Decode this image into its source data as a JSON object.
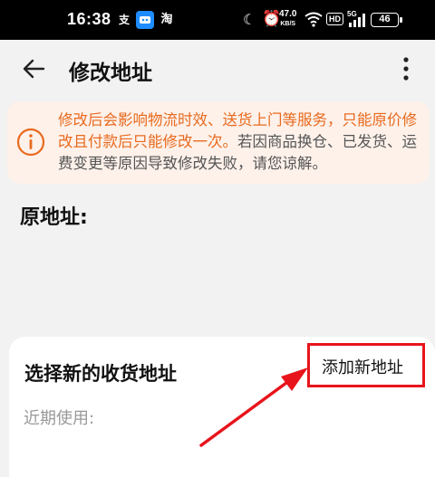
{
  "status_bar": {
    "time": "16:38",
    "app_icons": [
      "支",
      "淘"
    ],
    "network_speed_value": "47.0",
    "network_speed_unit": "KB/S",
    "hd": "HD",
    "signal": "5G",
    "battery": "46"
  },
  "header": {
    "title": "修改地址"
  },
  "notice": {
    "highlight": "修改后会影响物流时效、送货上门等服务，只能原价修改且付款后只能修改一次。",
    "rest": "若因商品换仓、已发货、运费变更等原因导致修改失败，请您谅解。",
    "accent_color": "#e86a1e"
  },
  "original_address": {
    "label": "原地址:"
  },
  "new_address": {
    "title": "选择新的收货地址",
    "add_button": "添加新地址",
    "recent_label": "近期使用:"
  },
  "annotation": {
    "color": "#e8141b"
  }
}
